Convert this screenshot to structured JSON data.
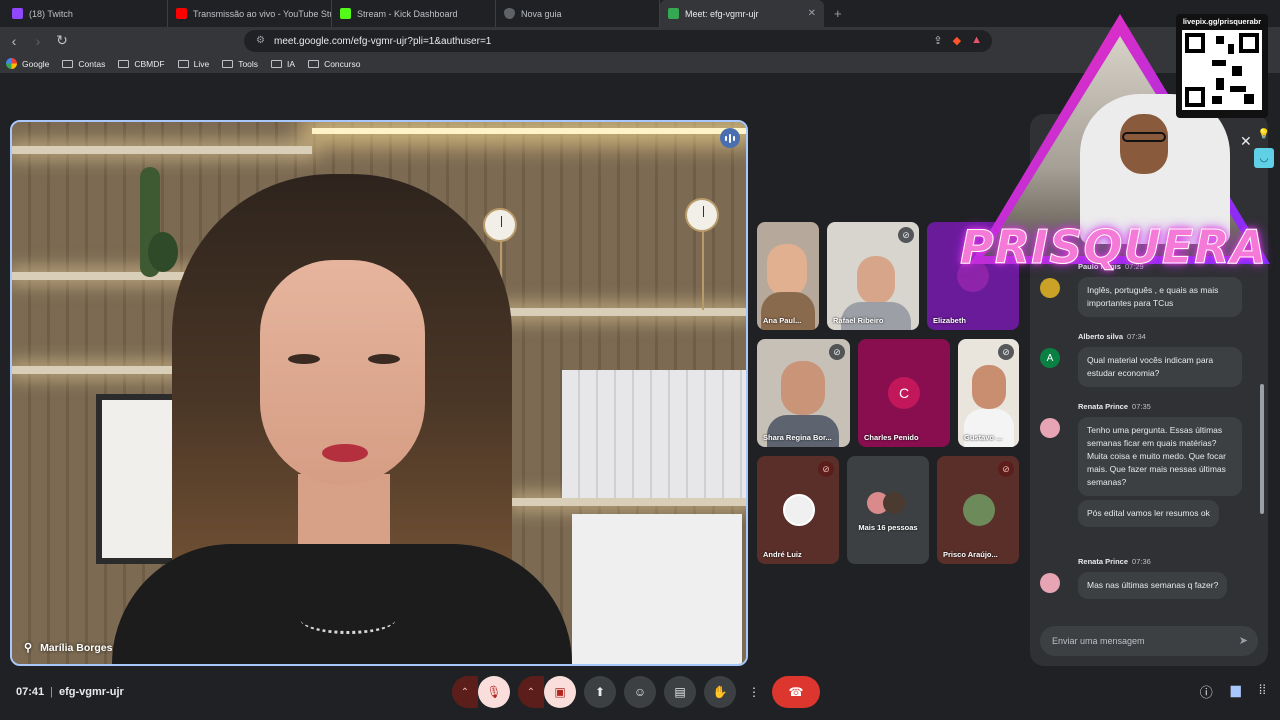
{
  "browser": {
    "tabs": [
      {
        "title": "(18) Twitch",
        "color": "#9146ff"
      },
      {
        "title": "Transmissão ao vivo - YouTube Studio",
        "color": "#ff0000"
      },
      {
        "title": "Stream - Kick Dashboard",
        "color": "#53fc18"
      },
      {
        "title": "Nova guia",
        "color": "#9aa0a6"
      },
      {
        "title": "Meet: efg-vgmr-ujr",
        "color": "#34a853",
        "active": true
      }
    ],
    "url": "meet.google.com/efg-vgmr-ujr?pli=1&authuser=1",
    "bookmarks": [
      "Google",
      "Contas",
      "CBMDF",
      "Live",
      "Tools",
      "IA",
      "Concurso"
    ]
  },
  "meeting": {
    "main_speaker": "Marília Borges",
    "time": "07:41",
    "code": "efg-vgmr-ujr",
    "participants": [
      {
        "name": "Ana Paul...",
        "muted": false,
        "type": "video"
      },
      {
        "name": "Rafael Ribeiro",
        "muted": true,
        "type": "video"
      },
      {
        "name": "Elizabeth",
        "muted": false,
        "type": "avatar",
        "color": "#8e24aa"
      },
      {
        "name": "Shara Regina Bor...",
        "muted": true,
        "type": "video"
      },
      {
        "name": "Charles Penido",
        "muted": false,
        "type": "avatar",
        "initial": "C",
        "color": "#ad1457"
      },
      {
        "name": "Gustavo ...",
        "muted": true,
        "type": "video"
      },
      {
        "name": "André Luiz",
        "muted": true,
        "type": "photo"
      },
      {
        "name": "Mais 16 pessoas",
        "muted": false,
        "type": "more"
      },
      {
        "name": "Prisco Araújo...",
        "muted": true,
        "type": "photo"
      }
    ]
  },
  "chat": {
    "messages": [
      {
        "sender": "Paulo Regis",
        "time": "07:29",
        "text": "Inglês, português , e quais as mais importantes para TCus"
      },
      {
        "sender": "Alberto silva",
        "time": "07:34",
        "initial": "A",
        "text": "Qual material vocês indicam para estudar economia?"
      },
      {
        "sender": "Renata Prince",
        "time": "07:35",
        "text": "Tenho uma pergunta.  Essas últimas semanas ficar em quais matérias?\nMuita coisa e muito medo.  Que focar mais.   Que fazer mais nessas últimas semanas?"
      },
      {
        "sender": "",
        "time": "",
        "text": "Pós edital vamos ler resumos ok"
      },
      {
        "sender": "Renata Prince",
        "time": "07:36",
        "text": "Mas nas últimas semanas q fazer?"
      }
    ],
    "input_placeholder": "Enviar uma mensagem"
  },
  "overlay": {
    "brand": "PRISQUERA",
    "livepix": "livepix.gg/prisquerabr"
  },
  "icons": {
    "mic": "mic-off-icon",
    "camera": "camera-off-icon",
    "present": "present-icon",
    "emoji": "emoji-icon",
    "captions": "captions-icon",
    "hand": "raise-hand-icon",
    "more": "more-options-icon",
    "end": "end-call-icon"
  }
}
